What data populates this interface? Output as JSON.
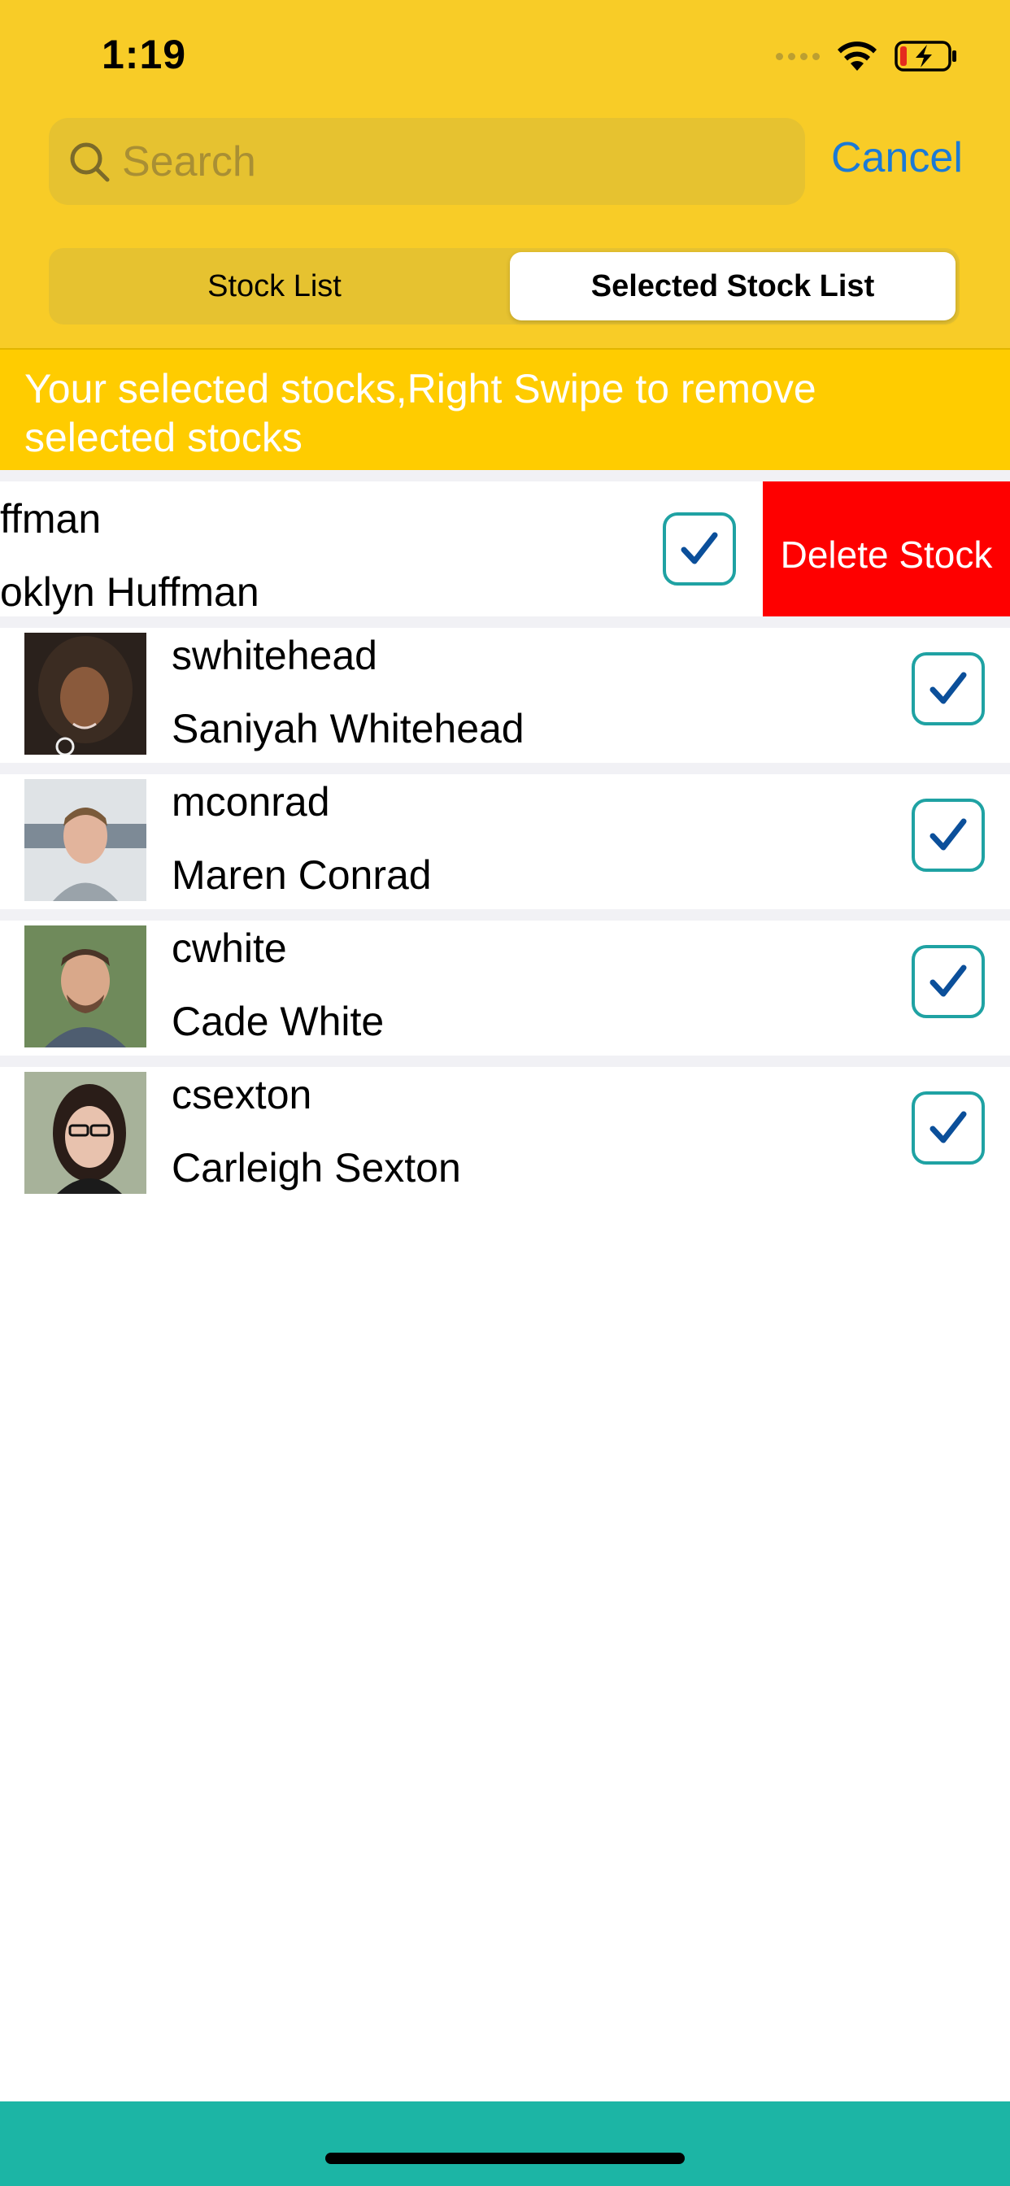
{
  "status_bar": {
    "time": "1:19",
    "icons": [
      "signal-dots-icon",
      "wifi-icon",
      "battery-charging-icon"
    ]
  },
  "search": {
    "placeholder": "Search",
    "value": "",
    "cancel_label": "Cancel"
  },
  "segments": {
    "tab1": "Stock List",
    "tab2": "Selected Stock List",
    "selected": "Selected Stock List"
  },
  "banner": {
    "line1": "Your selected stocks,Right Swipe to remove",
    "line2": "selected stocks"
  },
  "swiped_row": {
    "username": "ffman",
    "name": "oklyn Huffman",
    "delete_label": "Delete Stock",
    "checked": true
  },
  "stocks": [
    {
      "username": "swhitehead",
      "name": "Saniyah Whitehead",
      "checked": true
    },
    {
      "username": "mconrad",
      "name": "Maren Conrad",
      "checked": true
    },
    {
      "username": "cwhite",
      "name": "Cade White",
      "checked": true
    },
    {
      "username": "csexton",
      "name": "Carleigh Sexton",
      "checked": true
    }
  ],
  "colors": {
    "header": "#F8CC27",
    "banner": "#FFCC00",
    "delete": "#FE0000",
    "accent_blue": "#1b7ad6",
    "check_border": "#1fa2a3",
    "bottom_bar": "#1CB5A5"
  }
}
